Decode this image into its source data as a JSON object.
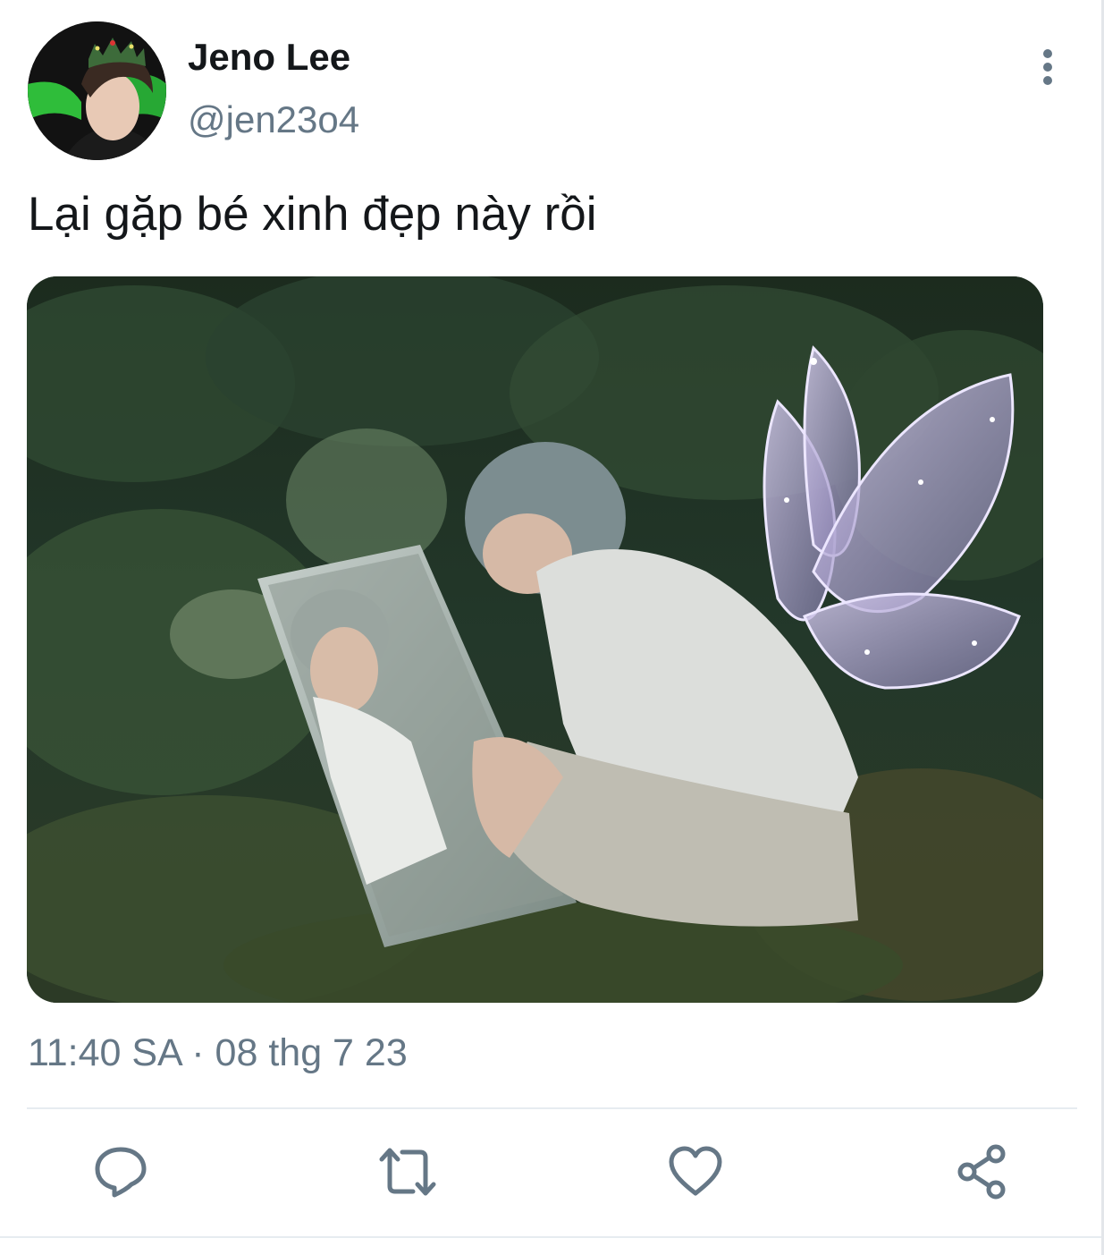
{
  "tweet": {
    "author": {
      "name": "Jeno Lee",
      "handle": "@jen23o4",
      "avatar_icon": "profile-photo"
    },
    "text": "Lại gặp bé xinh đẹp này rồi",
    "timestamp": "11:40 SA · 08 thg 7 23",
    "media_icon": "photo-forest-mirror-fairy-wings"
  },
  "actions": [
    {
      "icon": "reply-icon"
    },
    {
      "icon": "retweet-icon"
    },
    {
      "icon": "like-icon"
    },
    {
      "icon": "share-icon"
    }
  ],
  "colors": {
    "text": "#14171a",
    "secondary": "#657786",
    "icon": "#657786",
    "divider": "#e6ecf0"
  }
}
